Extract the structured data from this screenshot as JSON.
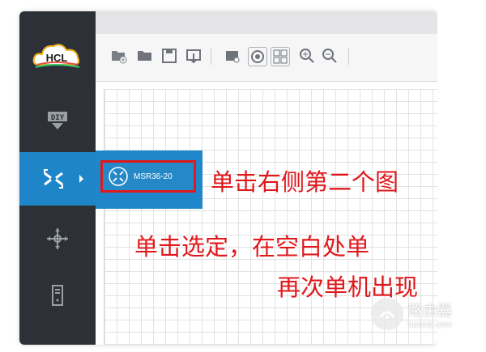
{
  "app": {
    "logo_text": "HCL"
  },
  "sidebar": {
    "items": [
      {
        "icon": "diy-icon",
        "active": false
      },
      {
        "icon": "router-icon",
        "active": true
      },
      {
        "icon": "move-icon",
        "active": false
      },
      {
        "icon": "server-icon",
        "active": false
      }
    ]
  },
  "toolbar": {
    "icons": [
      "new-topology-icon",
      "open-folder-icon",
      "save-icon",
      "export-icon",
      "screenshot-icon",
      "capture-icon",
      "grid-icon",
      "zoom-in-icon",
      "zoom-out-icon"
    ]
  },
  "popup": {
    "device_label": "MSR36-20"
  },
  "annotations": {
    "line1": "单击右侧第二个图",
    "line2": "单击选定，在空白处单",
    "line3": "再次单机出现"
  },
  "watermark": {
    "title": "路由器",
    "subtitle": "luyouqi.com"
  },
  "colors": {
    "sidebar": "#2d3137",
    "accent": "#1e86c8",
    "highlight": "#e0181c"
  }
}
